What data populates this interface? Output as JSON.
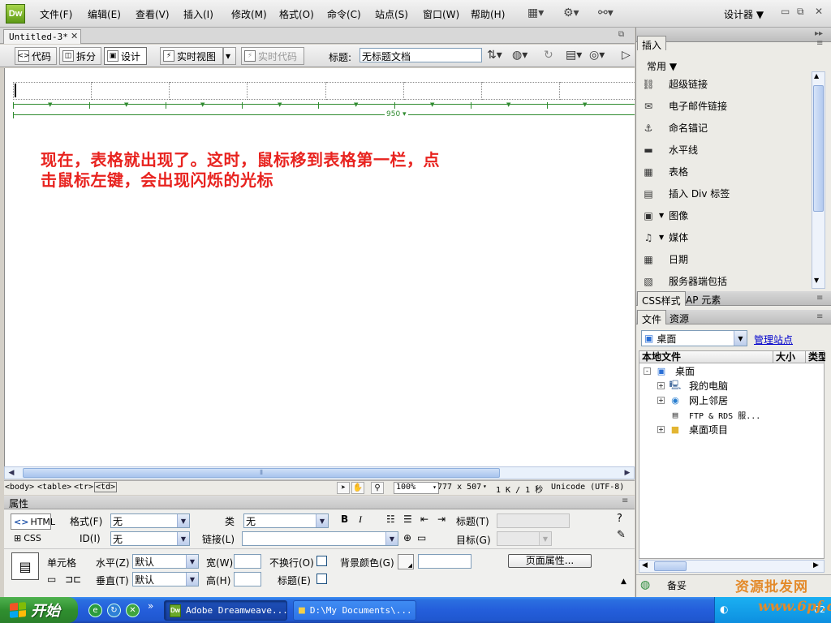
{
  "app": {
    "logo": "Dw",
    "menus": [
      "文件(F)",
      "编辑(E)",
      "查看(V)",
      "插入(I)",
      "修改(M)",
      "格式(O)",
      "命令(C)",
      "站点(S)",
      "窗口(W)",
      "帮助(H)"
    ],
    "workspace": "设计器 ▼",
    "window_controls": [
      "▭",
      "⧉",
      "✕"
    ]
  },
  "document": {
    "tab_label": "Untitled-3*",
    "tab_close": "✕",
    "toolbar": {
      "code": "代码",
      "split": "拆分",
      "design": "设计",
      "live_view": "实时视图",
      "live_code": "实时代码",
      "title_label": "标题:",
      "title_value": "无标题文档"
    },
    "canvas": {
      "width_label": "950 ▾",
      "annotation_line1": "现在，表格就出现了。这时，鼠标移到表格第一栏，点",
      "annotation_line2": "击鼠标左键，会出现闪烁的光标"
    },
    "status": {
      "tags": [
        "<body>",
        "<table>",
        "<tr>",
        "<td>"
      ],
      "zoom": "100%",
      "dimensions": "777 x 507",
      "size": "1 K / 1 秒",
      "encoding": "Unicode (UTF-8)"
    }
  },
  "properties": {
    "title": "属性",
    "html_label": "HTML",
    "css_label": "CSS",
    "format_label": "格式(F)",
    "format_value": "无",
    "class_label": "类",
    "class_value": "无",
    "id_label": "ID(I)",
    "id_value": "无",
    "link_label": "链接(L)",
    "link_value": "",
    "heading_label": "标题(T)",
    "target_label": "目标(G)",
    "cell_label": "单元格",
    "horz_label": "水平(Z)",
    "horz_value": "默认",
    "vert_label": "垂直(T)",
    "vert_value": "默认",
    "width_label": "宽(W)",
    "height_label": "高(H)",
    "nowrap_label": "不换行(O)",
    "header_label": "标题(E)",
    "bg_label": "背景颜色(G)",
    "page_props": "页面属性...",
    "bold": "B",
    "italic": "I"
  },
  "panels": {
    "insert_tab": "插入",
    "insert_category": "常用",
    "insert_items": [
      {
        "label": "超级链接",
        "icon": "link-icon"
      },
      {
        "label": "电子邮件链接",
        "icon": "email-icon"
      },
      {
        "label": "命名锚记",
        "icon": "anchor-icon"
      },
      {
        "label": "水平线",
        "icon": "hr-icon"
      },
      {
        "label": "表格",
        "icon": "table-icon"
      },
      {
        "label": "插入 Div 标签",
        "icon": "div-icon"
      },
      {
        "label": "图像",
        "icon": "image-icon"
      },
      {
        "label": "媒体",
        "icon": "media-icon"
      },
      {
        "label": "日期",
        "icon": "calendar-icon"
      },
      {
        "label": "服务器端包括",
        "icon": "include-icon"
      }
    ],
    "css_tab": "CSS样式",
    "ap_tab": "AP 元素",
    "files_tab": "文件",
    "assets_tab": "资源",
    "site_value": "桌面",
    "manage_site": "管理站点",
    "col_local": "本地文件",
    "col_size": "大小",
    "col_type": "类型",
    "tree": [
      {
        "label": "桌面",
        "level": 0,
        "icon": "desktop-icon",
        "expander": "-"
      },
      {
        "label": "我的电脑",
        "level": 1,
        "icon": "computer-icon",
        "expander": "+"
      },
      {
        "label": "网上邻居",
        "level": 1,
        "icon": "network-icon",
        "expander": "+"
      },
      {
        "label": "FTP & RDS 服...",
        "level": 1,
        "icon": "ftp-icon",
        "expander": ""
      },
      {
        "label": "桌面项目",
        "level": 1,
        "icon": "folder-icon",
        "expander": "+"
      }
    ],
    "footer_label": "备妥"
  },
  "taskbar": {
    "start": "开始",
    "tasks": [
      "Adobe Dreamweave...",
      "D:\\My Documents\\..."
    ],
    "quick_more": "»",
    "tray_time": "02"
  },
  "watermark": {
    "line1": "资源批发网",
    "line2": "www.6pf.cn"
  },
  "colors": {
    "annotation": "#e8231f",
    "guide": "#2f8b2f",
    "taskbar": "#245edb"
  }
}
